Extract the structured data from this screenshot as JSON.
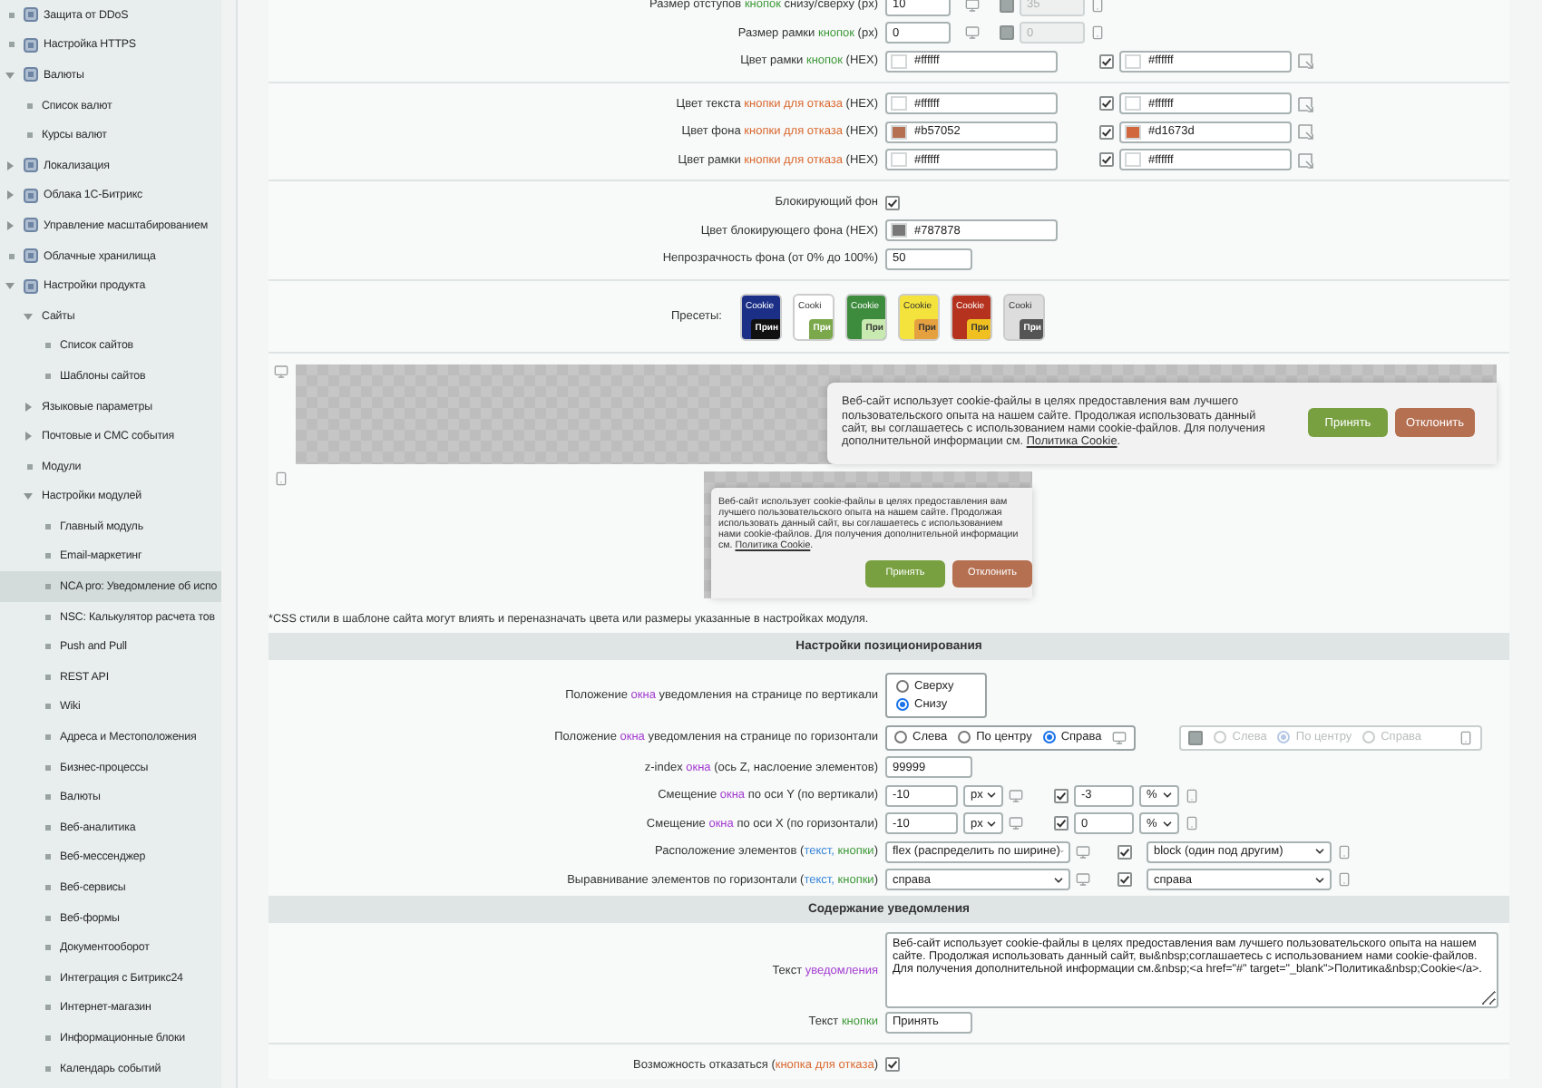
{
  "sidebar": {
    "items": [
      {
        "label": "Защита от DDoS",
        "kind": "leaf",
        "selected": false
      },
      {
        "label": "Настройка HTTPS",
        "kind": "leaf",
        "selected": false
      },
      {
        "label": "Валюты",
        "kind": "folder",
        "expanded": true,
        "selected": false,
        "children": [
          {
            "label": "Список валют",
            "kind": "leaf",
            "selected": false
          },
          {
            "label": "Курсы валют",
            "kind": "leaf",
            "selected": false
          }
        ]
      },
      {
        "label": "Локализация",
        "kind": "folder",
        "expanded": false,
        "selected": false
      },
      {
        "label": "Облака 1С-Битрикс",
        "kind": "folder",
        "expanded": false,
        "selected": false
      },
      {
        "label": "Управление масштабированием",
        "kind": "folder",
        "expanded": false,
        "selected": false
      },
      {
        "label": "Облачные хранилища",
        "kind": "leaf",
        "selected": false
      },
      {
        "label": "Настройки продукта",
        "kind": "folder",
        "expanded": true,
        "selected": false,
        "children": [
          {
            "label": "Сайты",
            "kind": "folder",
            "expanded": true,
            "selected": false,
            "children": [
              {
                "label": "Список сайтов",
                "kind": "leaf",
                "selected": false
              },
              {
                "label": "Шаблоны сайтов",
                "kind": "leaf",
                "selected": false
              }
            ]
          },
          {
            "label": "Языковые параметры",
            "kind": "folder",
            "expanded": false,
            "selected": false
          },
          {
            "label": "Почтовые и СМС события",
            "kind": "folder",
            "expanded": false,
            "selected": false
          },
          {
            "label": "Модули",
            "kind": "leaf",
            "selected": false
          },
          {
            "label": "Настройки модулей",
            "kind": "folder",
            "expanded": true,
            "selected": false,
            "children": [
              {
                "label": "Главный модуль",
                "kind": "leaf",
                "selected": false
              },
              {
                "label": "Email-маркетинг",
                "kind": "leaf",
                "selected": false
              },
              {
                "label": "NCA pro: Уведомление об испо",
                "kind": "leaf",
                "selected": true
              },
              {
                "label": "NSC: Калькулятор расчета тов",
                "kind": "leaf",
                "selected": false
              },
              {
                "label": "Push and Pull",
                "kind": "leaf",
                "selected": false
              },
              {
                "label": "REST API",
                "kind": "leaf",
                "selected": false
              },
              {
                "label": "Wiki",
                "kind": "leaf",
                "selected": false
              },
              {
                "label": "Адреса и Местоположения",
                "kind": "leaf",
                "selected": false
              },
              {
                "label": "Бизнес-процессы",
                "kind": "leaf",
                "selected": false
              },
              {
                "label": "Валюты",
                "kind": "leaf",
                "selected": false
              },
              {
                "label": "Веб-аналитика",
                "kind": "leaf",
                "selected": false
              },
              {
                "label": "Веб-мессенджер",
                "kind": "leaf",
                "selected": false
              },
              {
                "label": "Веб-сервисы",
                "kind": "leaf",
                "selected": false
              },
              {
                "label": "Веб-формы",
                "kind": "leaf",
                "selected": false
              },
              {
                "label": "Документооборот",
                "kind": "leaf",
                "selected": false
              },
              {
                "label": "Интеграция с Битрикс24",
                "kind": "leaf",
                "selected": false
              },
              {
                "label": "Интернет-магазин",
                "kind": "leaf",
                "selected": false
              },
              {
                "label": "Информационные блоки",
                "kind": "leaf",
                "selected": false
              },
              {
                "label": "Календарь событий",
                "kind": "leaf",
                "selected": false
              }
            ]
          }
        ]
      }
    ]
  },
  "main": {
    "rows": [
      {
        "kind": "number",
        "label": [
          {
            "text": "Размер отступов "
          },
          {
            "text": "кнопок",
            "color": "#3f9a3a"
          },
          {
            "text": " снизу/сверху (px)"
          }
        ],
        "value": "10",
        "mobile": {
          "enabled": false,
          "value": "35"
        }
      },
      {
        "kind": "number",
        "label": [
          {
            "text": "Размер рамки "
          },
          {
            "text": "кнопок",
            "color": "#3f9a3a"
          },
          {
            "text": " (px)"
          }
        ],
        "value": "0",
        "mobile": {
          "enabled": false,
          "value": "0"
        }
      },
      {
        "kind": "color",
        "label": [
          {
            "text": "Цвет рамки "
          },
          {
            "text": "кнопок",
            "color": "#3f9a3a"
          },
          {
            "text": " (HEX)"
          }
        ],
        "value": "#ffffff",
        "color": "#ffffff",
        "mobile": {
          "enabled": true,
          "value": "#ffffff",
          "color": "#ffffff"
        }
      },
      {
        "kind": "divider"
      },
      {
        "kind": "color",
        "label": [
          {
            "text": "Цвет текста "
          },
          {
            "text": "кнопки для отказа",
            "color": "#d9692f"
          },
          {
            "text": " (HEX)"
          }
        ],
        "value": "#ffffff",
        "color": "#ffffff",
        "mobile": {
          "enabled": true,
          "value": "#ffffff",
          "color": "#ffffff"
        }
      },
      {
        "kind": "color",
        "label": [
          {
            "text": "Цвет фона "
          },
          {
            "text": "кнопки для отказа",
            "color": "#d9692f"
          },
          {
            "text": " (HEX)"
          }
        ],
        "value": "#b57052",
        "color": "#b57052",
        "mobile": {
          "enabled": true,
          "value": "#d1673d",
          "color": "#d1673d"
        }
      },
      {
        "kind": "color",
        "label": [
          {
            "text": "Цвет рамки "
          },
          {
            "text": "кнопки для отказа",
            "color": "#d9692f"
          },
          {
            "text": " (HEX)"
          }
        ],
        "value": "#ffffff",
        "color": "#ffffff",
        "mobile": {
          "enabled": true,
          "value": "#ffffff",
          "color": "#ffffff"
        }
      },
      {
        "kind": "divider"
      },
      {
        "kind": "toggle",
        "label": [
          {
            "text": "Блокирующий фон"
          }
        ],
        "checked": true
      },
      {
        "kind": "color",
        "label": [
          {
            "text": "Цвет блокирующего фона (HEX)"
          }
        ],
        "value": "#787878",
        "color": "#787878"
      },
      {
        "kind": "text",
        "label": [
          {
            "text": "Непрозрачность фона (от 0% до 100%)"
          }
        ],
        "value": "50"
      },
      {
        "kind": "divider"
      },
      {
        "kind": "presets",
        "label": [
          {
            "text": "Пресеты:"
          }
        ],
        "items": [
          {
            "title": "Cookie",
            "button": {
              "text": "Прин",
              "color": "#111111"
            },
            "color": "#1b2f86"
          },
          {
            "title": "Cooki",
            "button": {
              "text": "При",
              "color": "#7aa84a"
            },
            "color": "#ffffff"
          },
          {
            "title": "Cookie",
            "button": {
              "text": "При",
              "color": "#c8eab0"
            },
            "color": "#3d8b3d"
          },
          {
            "title": "Cookie",
            "button": {
              "text": "При",
              "color": "#e5a040"
            },
            "color": "#f3e33c"
          },
          {
            "title": "Cookie",
            "button": {
              "text": "При",
              "color": "#f0c020"
            },
            "color": "#b4321e"
          },
          {
            "title": "Cooki",
            "button": {
              "text": "При",
              "color": "#555555"
            },
            "color": "#dddddd"
          }
        ]
      },
      {
        "kind": "divider"
      },
      {
        "kind": "preview-desktop",
        "text": "Веб-сайт использует cookie-файлы в целях предоставления вам лучшего пользовательского опыта на нашем сайте. Продолжая использовать данный сайт, вы соглашаетесь с использованием нами cookie-файлов. Для получения дополнительной информации см. ",
        "link": "Политика Cookie",
        "after": ".",
        "accept": "Принять",
        "decline": "Отклонить"
      },
      {
        "kind": "preview-mobile",
        "text": "Веб-сайт использует cookie-файлы в целях предоставления вам лучшего пользовательского опыта на нашем сайте. Продолжая использовать данный сайт, вы соглашаетесь с использованием нами cookie-файлов. Для получения дополнительной информации см. ",
        "link": "Политика Cookie",
        "after": ".",
        "accept": "Принять",
        "decline": "Отклонить"
      },
      {
        "kind": "note",
        "text": "*CSS стили в шаблоне сайта могут влиять и переназначать цвета или размеры указанные в настройках модуля."
      },
      {
        "kind": "header",
        "title": "Настройки позиционирования"
      },
      {
        "kind": "radios-vertical",
        "label": [
          {
            "text": "Положение "
          },
          {
            "text": "окна",
            "color": "#a23bd0"
          },
          {
            "text": " уведомления на странице по вертикали"
          }
        ],
        "options": [
          {
            "label": "Сверху",
            "selected": false
          },
          {
            "label": "Снизу",
            "selected": true
          }
        ]
      },
      {
        "kind": "radios-horizontal",
        "label": [
          {
            "text": "Положение "
          },
          {
            "text": "окна",
            "color": "#a23bd0"
          },
          {
            "text": " уведомления на странице по горизонтали"
          }
        ],
        "options": [
          {
            "label": "Слева",
            "selected": false
          },
          {
            "label": "По центру",
            "selected": false
          },
          {
            "label": "Справа",
            "selected": true
          }
        ],
        "mobile": {
          "enabled": false,
          "options": [
            {
              "label": "Слева",
              "selected": false
            },
            {
              "label": "По центру",
              "selected": true
            },
            {
              "label": "Справа",
              "selected": false
            }
          ]
        }
      },
      {
        "kind": "text",
        "label": [
          {
            "text": "z-index "
          },
          {
            "text": "окна",
            "color": "#a23bd0"
          },
          {
            "text": " (ось Z, наслоение элементов)"
          }
        ],
        "value": "99999"
      },
      {
        "kind": "offset",
        "label": [
          {
            "text": "Смещение "
          },
          {
            "text": "окна",
            "color": "#a23bd0"
          },
          {
            "text": " по оси Y (по вертикали)"
          }
        ],
        "value": "-10",
        "unit": "px",
        "mobile": {
          "enabled": true,
          "value": "-3",
          "unit": "%"
        }
      },
      {
        "kind": "offset",
        "label": [
          {
            "text": "Смещение "
          },
          {
            "text": "окна",
            "color": "#a23bd0"
          },
          {
            "text": " по оси X (по горизонтали)"
          }
        ],
        "value": "-10",
        "unit": "px",
        "mobile": {
          "enabled": true,
          "value": "0",
          "unit": "%"
        }
      },
      {
        "kind": "select",
        "label": [
          {
            "text": "Расположение элементов ("
          },
          {
            "text": "текст,",
            "color": "#3987d8"
          },
          {
            "text": " кнопки",
            "color": "#3f9a3a"
          },
          {
            "text": ")"
          }
        ],
        "value": "flex (распределить по ширине)",
        "mobile": {
          "enabled": true,
          "value": "block (один под другим)"
        }
      },
      {
        "kind": "select",
        "label": [
          {
            "text": "Выравнивание элементов по горизонтали ("
          },
          {
            "text": "текст,",
            "color": "#3987d8"
          },
          {
            "text": " кнопки",
            "color": "#3f9a3a"
          },
          {
            "text": ")"
          }
        ],
        "value": "справа",
        "mobile": {
          "enabled": true,
          "value": "справа"
        }
      },
      {
        "kind": "header",
        "title": "Содержание уведомления"
      },
      {
        "kind": "textarea",
        "label": [
          {
            "text": "Текст "
          },
          {
            "text": "уведомления",
            "color": "#a23bd0"
          }
        ],
        "value": "Веб-сайт использует cookie-файлы в целях предоставления вам лучшего пользовательского опыта на нашем сайте. Продолжая использовать данный сайт, вы&nbsp;соглашаетесь с использованием нами cookie-файлов. Для получения дополнительной информации см.&nbsp;<a href=\"#\" target=\"_blank\">Политика&nbsp;Cookie</a>."
      },
      {
        "kind": "text",
        "label": [
          {
            "text": "Текст "
          },
          {
            "text": "кнопки",
            "color": "#3f9a3a"
          }
        ],
        "value": "Принять"
      },
      {
        "kind": "divider"
      },
      {
        "kind": "toggle",
        "label": [
          {
            "text": "Возможность отказаться ("
          },
          {
            "text": "кнопка для отказа",
            "color": "#d9692f"
          },
          {
            "text": ")"
          }
        ],
        "checked": true
      }
    ]
  }
}
